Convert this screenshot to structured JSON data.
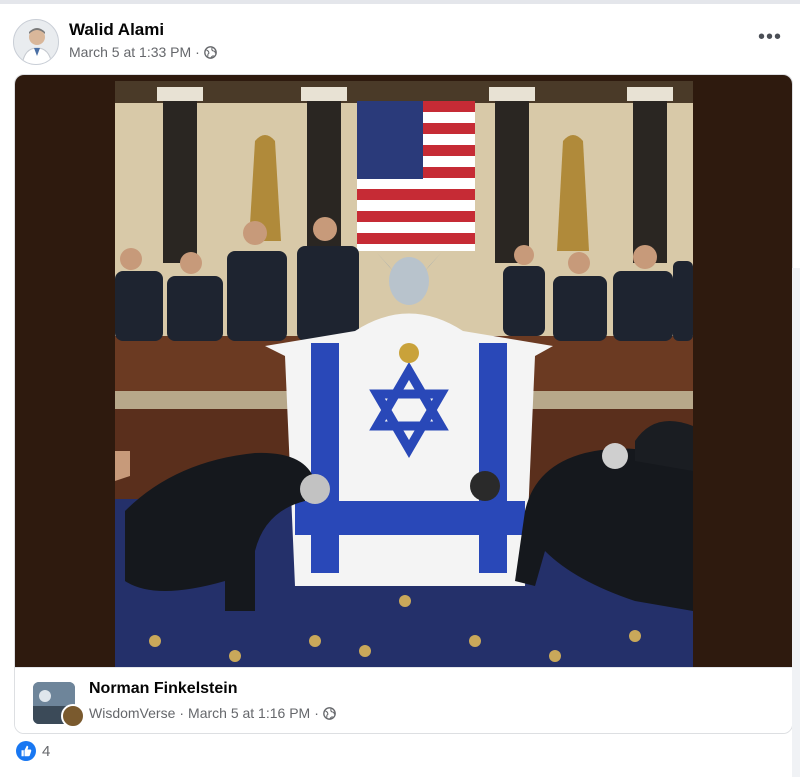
{
  "post": {
    "author": "Walid Alami",
    "timestamp": "March 5 at 1:33 PM",
    "separator": "·",
    "audience_icon": "globe-icon",
    "more_label": "•••"
  },
  "shared": {
    "image_icon": "image",
    "source_name": "Norman Finkelstein",
    "source_page": "WisdomVerse",
    "source_timestamp": "March 5 at 1:16 PM",
    "separator1": "·",
    "separator2": "·",
    "audience_icon": "globe-icon"
  },
  "reactions": {
    "icon": "like-icon",
    "count": "4"
  },
  "colors": {
    "link_blue": "#1877f2",
    "meta_gray": "#65676b",
    "media_bg": "#2e1a0e"
  }
}
